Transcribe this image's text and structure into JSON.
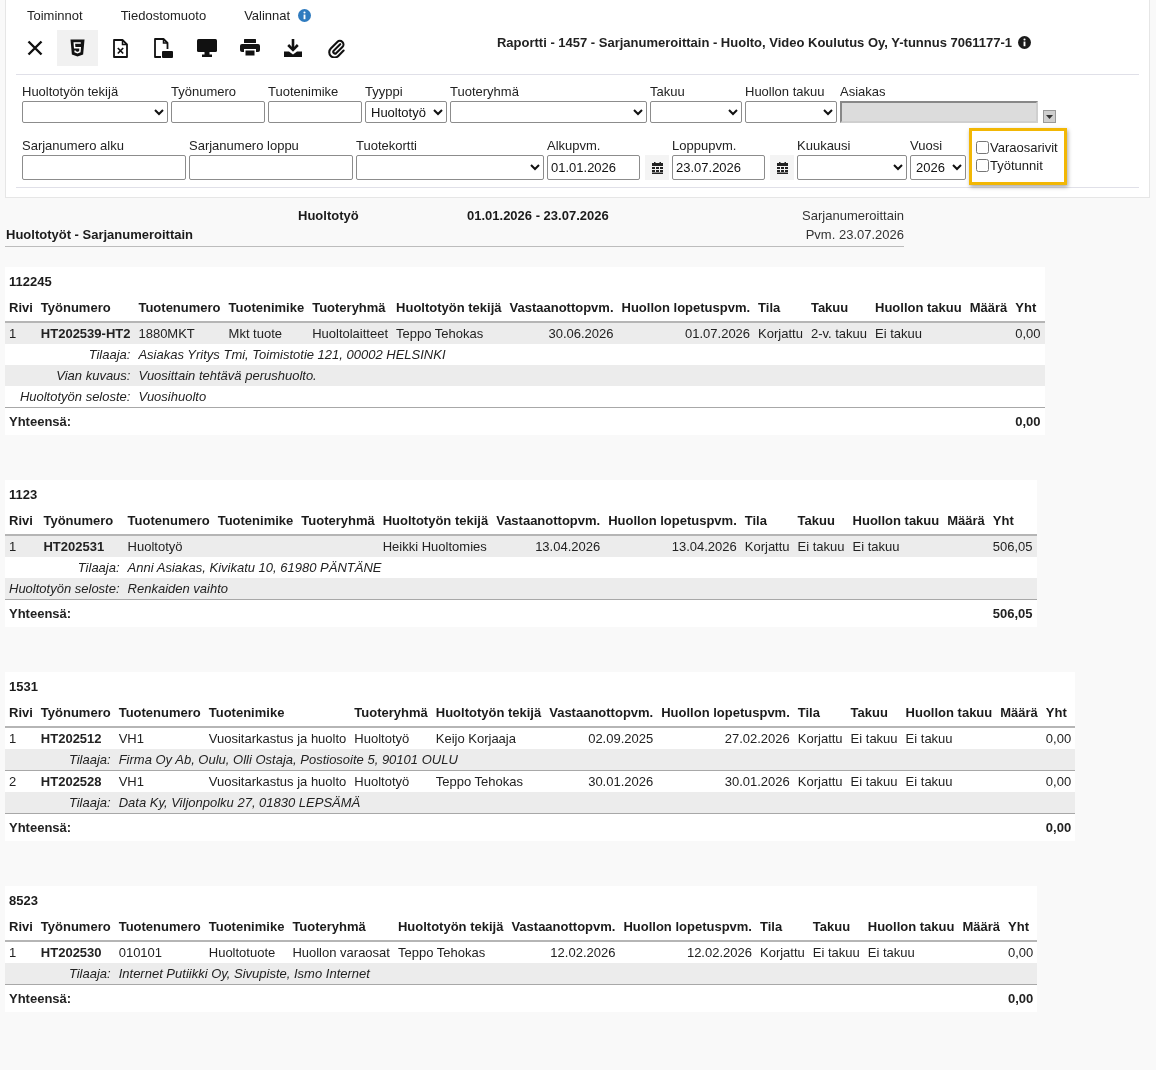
{
  "menu": [
    {
      "label": "Toiminnot",
      "info": false
    },
    {
      "label": "Tiedostomuoto",
      "info": false
    },
    {
      "label": "Valinnat",
      "info": true
    }
  ],
  "toolbar": [
    {
      "kind": "close",
      "selected": false
    },
    {
      "kind": "html",
      "selected": true
    },
    {
      "kind": "spreadsheet",
      "selected": false
    },
    {
      "kind": "pdf",
      "selected": false
    },
    {
      "kind": "screen",
      "selected": false
    },
    {
      "kind": "print",
      "selected": false
    },
    {
      "kind": "download",
      "selected": false
    },
    {
      "kind": "attach",
      "selected": false
    }
  ],
  "report_title": {
    "text": "Raportti - 1457 - Sarjanumeroittain - Huolto, Video Koulutus Oy, Y-tunnus 7061177-1",
    "info": true
  },
  "filters": {
    "rows": [
      {
        "fields": [
          {
            "label": "Huoltotyön tekijä",
            "kind": "select"
          },
          {
            "label": "Työnumero",
            "kind": "text"
          },
          {
            "label": "Tuotenimike",
            "kind": "text"
          },
          {
            "label": "Tyyppi",
            "kind": "select",
            "value": "Huoltotyö"
          },
          {
            "label": "Tuoteryhmä",
            "kind": "select"
          },
          {
            "label": "Takuu",
            "kind": "select"
          },
          {
            "label": "Huollon takuu",
            "kind": "select"
          },
          {
            "label": "Asiakas",
            "kind": "lookup"
          }
        ]
      },
      {
        "fields": [
          {
            "label": "Sarjanumero alku",
            "kind": "text"
          },
          {
            "label": "Sarjanumero loppu",
            "kind": "text"
          },
          {
            "label": "Tuotekortti",
            "kind": "select"
          },
          {
            "label": "Alkupvm.",
            "kind": "date",
            "value": "01.01.2026"
          },
          {
            "label": "Loppupvm.",
            "kind": "date",
            "value": "23.07.2026"
          },
          {
            "label": "Kuukausi",
            "kind": "select"
          },
          {
            "label": "Vuosi",
            "kind": "select",
            "value": "2026"
          }
        ]
      }
    ],
    "options": {
      "highlighted": true,
      "items": [
        {
          "label": "Varaosarivit",
          "checked": false
        },
        {
          "label": "Työtunnit",
          "checked": false
        }
      ]
    }
  },
  "report_header": {
    "type": "Huoltotyö",
    "period": "01.01.2026 - 23.07.2026",
    "grouping": "Sarjanumeroittain",
    "title": "Huoltotyöt - Sarjanumeroittain",
    "date": "Pvm. 23.07.2026"
  },
  "sections": [
    {
      "group": "112245",
      "columns": [
        "Rivi",
        "Työnumero",
        "Tuotenumero",
        "Tuotenimike",
        "Tuoteryhmä",
        "Huoltotyön tekijä",
        "Vastaanottopvm.",
        "Huollon lopetuspvm.",
        "Tila",
        "Takuu",
        "Huollon takuu",
        "Määrä",
        "Yht"
      ],
      "items": [
        {
          "shaded": true,
          "cells": {
            "row": "1",
            "work_number": "HT202539-HT2",
            "product_number": "1880MKT",
            "product_name": "Mkt tuote",
            "product_group": "Huoltolaitteet",
            "technician": "Teppo Tehokas",
            "received": "30.06.2026",
            "completed": "01.07.2026",
            "status": "Korjattu",
            "warranty": "2-v. takuu",
            "service_warranty": "Ei takuu",
            "total": "0,00"
          },
          "details": [
            {
              "label": "Tilaaja:",
              "value": "Asiakas Yritys Tmi, Toimistotie 121, 00002 HELSINKI",
              "shaded": false
            },
            {
              "label": "Vian kuvaus:",
              "value": "Vuosittain tehtävä perushuolto.",
              "shaded": true
            },
            {
              "label": "Huoltotyön seloste:",
              "value": "Vuosihuolto",
              "shaded": false
            }
          ]
        }
      ],
      "total_label": "Yhteensä:",
      "total": "0,00"
    },
    {
      "group": "1123",
      "columns": [
        "Rivi",
        "Työnumero",
        "Tuotenumero",
        "Tuotenimike",
        "Tuoteryhmä",
        "Huoltotyön tekijä",
        "Vastaanottopvm.",
        "Huollon lopetuspvm.",
        "Tila",
        "Takuu",
        "Huollon takuu",
        "Määrä",
        "Yht"
      ],
      "items": [
        {
          "shaded": true,
          "cells": {
            "row": "1",
            "work_number": "HT202531",
            "product_number": "Huoltotyö",
            "technician": "Heikki Huoltomies",
            "received": "13.04.2026",
            "completed": "13.04.2026",
            "status": "Korjattu",
            "warranty": "Ei takuu",
            "service_warranty": "Ei takuu",
            "total": "506,05"
          },
          "details": [
            {
              "label": "Tilaaja:",
              "value": "Anni Asiakas, Kivikatu 10, 61980 PÄNTÄNE",
              "shaded": false
            },
            {
              "label": "Huoltotyön seloste:",
              "value": "Renkaiden vaihto",
              "shaded": true
            }
          ]
        }
      ],
      "total_label": "Yhteensä:",
      "total": "506,05"
    },
    {
      "group": "1531",
      "columns": [
        "Rivi",
        "Työnumero",
        "Tuotenumero",
        "Tuotenimike",
        "Tuoteryhmä",
        "Huoltotyön tekijä",
        "Vastaanottopvm.",
        "Huollon lopetuspvm.",
        "Tila",
        "Takuu",
        "Huollon takuu",
        "Määrä",
        "Yht"
      ],
      "items": [
        {
          "shaded": false,
          "cells": {
            "row": "1",
            "work_number": "HT202512",
            "product_number": "VH1",
            "product_name": "Vuositarkastus ja huolto",
            "product_group": "Huoltotyö",
            "technician": "Keijo Korjaaja",
            "received": "02.09.2025",
            "completed": "27.02.2026",
            "status": "Korjattu",
            "warranty": "Ei takuu",
            "service_warranty": "Ei takuu",
            "total": "0,00"
          },
          "details": [
            {
              "label": "Tilaaja:",
              "value": "Firma Oy Ab, Oulu, Olli Ostaja, Postiosoite 5, 90101 OULU",
              "shaded": true
            }
          ]
        },
        {
          "shaded": false,
          "cells": {
            "row": "2",
            "work_number": "HT202528",
            "product_number": "VH1",
            "product_name": "Vuositarkastus ja huolto",
            "product_group": "Huoltotyö",
            "technician": "Teppo Tehokas",
            "received": "30.01.2026",
            "completed": "30.01.2026",
            "status": "Korjattu",
            "warranty": "Ei takuu",
            "service_warranty": "Ei takuu",
            "total": "0,00"
          },
          "details": [
            {
              "label": "Tilaaja:",
              "value": "Data Ky, Viljonpolku 27, 01830 LEPSÄMÄ",
              "shaded": true
            }
          ]
        }
      ],
      "total_label": "Yhteensä:",
      "total": "0,00"
    },
    {
      "group": "8523",
      "columns": [
        "Rivi",
        "Työnumero",
        "Tuotenumero",
        "Tuotenimike",
        "Tuoteryhmä",
        "Huoltotyön tekijä",
        "Vastaanottopvm.",
        "Huollon lopetuspvm.",
        "Tila",
        "Takuu",
        "Huollon takuu",
        "Määrä",
        "Yht"
      ],
      "items": [
        {
          "shaded": false,
          "cells": {
            "row": "1",
            "work_number": "HT202530",
            "product_number": "010101",
            "product_name": "Huoltotuote",
            "product_group": "Huollon varaosat",
            "technician": "Teppo Tehokas",
            "received": "12.02.2026",
            "completed": "12.02.2026",
            "status": "Korjattu",
            "warranty": "Ei takuu",
            "service_warranty": "Ei takuu",
            "total": "0,00"
          },
          "details": [
            {
              "label": "Tilaaja:",
              "value": "Internet Putiikki Oy, Sivupiste, Ismo Internet",
              "shaded": true
            }
          ]
        }
      ],
      "total_label": "Yhteensä:",
      "total": "0,00"
    }
  ]
}
